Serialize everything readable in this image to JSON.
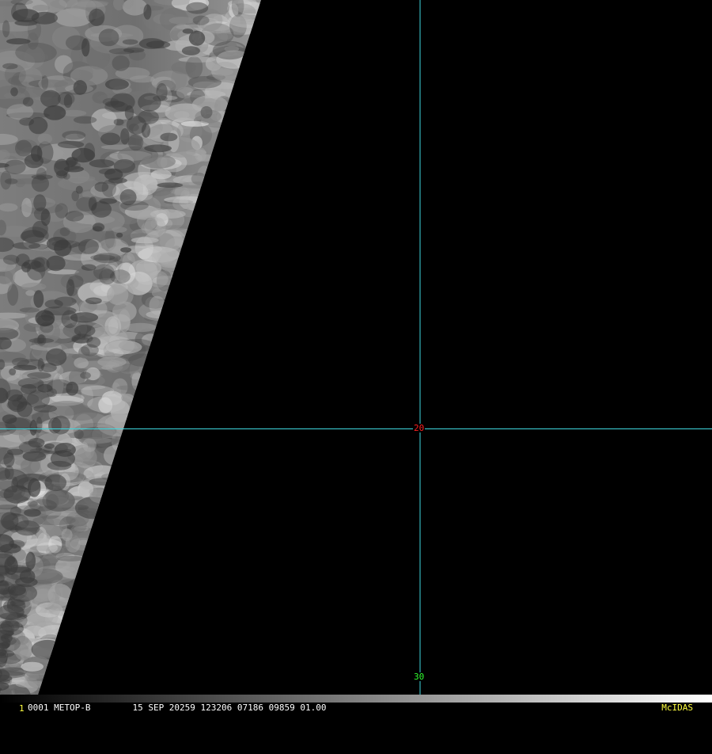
{
  "image": {
    "satellite": "METOP-B",
    "frame_number": "1",
    "status_line": "0001 METOP-B        15 SEP 20259 123206 07186 09859 01.00",
    "software_label": "McIDAS"
  },
  "grid": {
    "line_color": "#3fd8e0",
    "labels": [
      {
        "text": "20",
        "color": "#ff2020"
      },
      {
        "text": "30",
        "color": "#30ff30"
      }
    ]
  },
  "colors": {
    "background": "#000000",
    "status_text": "#ffffff",
    "label_yellow": "#ffff40"
  }
}
